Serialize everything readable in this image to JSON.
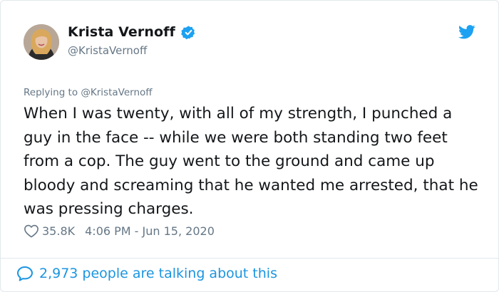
{
  "author": {
    "display_name": "Krista Vernoff",
    "handle": "@KristaVernoff",
    "verified": true
  },
  "reply": {
    "prefix": "Replying to ",
    "mention": "@KristaVernoff"
  },
  "tweet": {
    "text": "When I was twenty, with all of my strength, I punched a guy in the face -- while we were both standing two feet from a cop. The guy went to the ground and came up bloody and screaming that he wanted me arrested, that he was pressing charges."
  },
  "stats": {
    "likes": "35.8K",
    "timestamp": "4:06 PM - Jun 15, 2020"
  },
  "footer": {
    "talking_label": "2,973 people are talking about this"
  },
  "icons": {
    "verified": "verified-badge-icon",
    "brand": "twitter-bird-icon",
    "like": "heart-icon",
    "comment": "speech-bubble-icon"
  },
  "colors": {
    "accent": "#1da1f2",
    "link": "#1b95e0",
    "muted": "#657786",
    "text": "#14171a",
    "border": "#e1e8ed"
  }
}
